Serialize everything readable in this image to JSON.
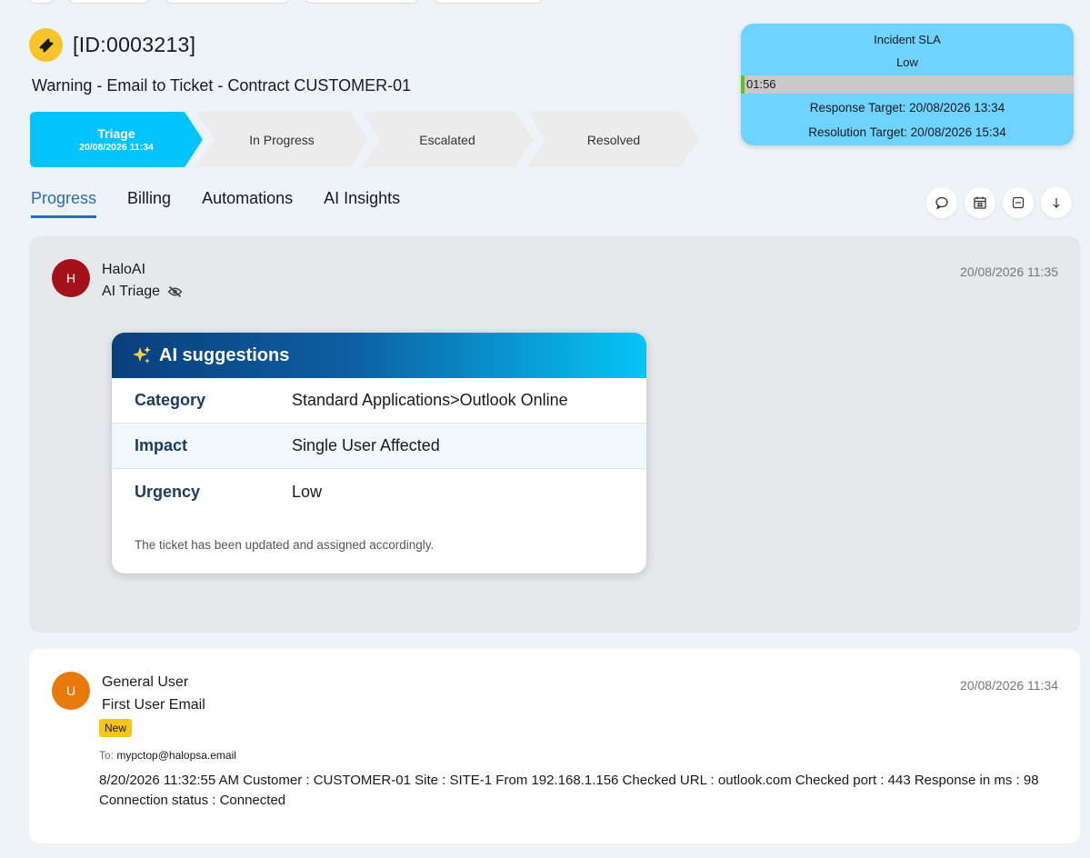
{
  "ticket": {
    "id": "[ID:0003213]",
    "summary": "Warning - Email to Ticket - Contract CUSTOMER-01"
  },
  "stages": [
    {
      "label": "Triage",
      "date": "20/08/2026 11:34",
      "active": true
    },
    {
      "label": "In Progress",
      "date": "",
      "active": false
    },
    {
      "label": "Escalated",
      "date": "",
      "active": false
    },
    {
      "label": "Resolved",
      "date": "",
      "active": false
    }
  ],
  "sla": {
    "title": "Incident SLA",
    "priority": "Low",
    "elapsed": "01:56",
    "progress_fraction": 0.01,
    "response_target": "Response Target: 20/08/2026 13:34",
    "resolution_target": "Resolution Target: 20/08/2026 15:34"
  },
  "tabs": [
    {
      "label": "Progress",
      "active": true
    },
    {
      "label": "Billing",
      "active": false
    },
    {
      "label": "Automations",
      "active": false
    },
    {
      "label": "AI Insights",
      "active": false
    }
  ],
  "toolbar": {
    "icons": [
      "comment-icon",
      "calendar-icon",
      "collapse-icon",
      "arrow-down-icon"
    ]
  },
  "ai_action": {
    "avatar_letter": "H",
    "author": "HaloAI",
    "subtitle": "AI Triage",
    "timestamp": "20/08/2026 11:35",
    "box": {
      "title": "AI suggestions",
      "rows": [
        {
          "label": "Category",
          "value": "Standard Applications>Outlook Online"
        },
        {
          "label": "Impact",
          "value": "Single User Affected"
        },
        {
          "label": "Urgency",
          "value": "Low"
        }
      ],
      "note": "The ticket has been updated and assigned accordingly."
    }
  },
  "email_action": {
    "avatar_letter": "U",
    "author": "General User",
    "subtitle": "First User Email",
    "badge": "New",
    "timestamp": "20/08/2026 11:34",
    "to_label": "To:",
    "to_address": "mypctop@halopsa.email",
    "body": "8/20/2026 11:32:55 AM Customer : CUSTOMER-01 Site : SITE-1 From 192.168.1.156 Checked URL : outlook.com Checked port : 443 Response in ms : 98 Connection status : Connected"
  },
  "colors": {
    "accent_blue": "#2a6cb0",
    "stage_active": "#00c3ff",
    "stage_inactive": "#ececec",
    "sla_bg": "#6fd3ff",
    "sla_fill": "#5bc51d",
    "avatar_halo": "#a3121a",
    "avatar_user": "#e8790b",
    "badge": "#f5c518",
    "ticket_icon": "#f7c52b"
  }
}
